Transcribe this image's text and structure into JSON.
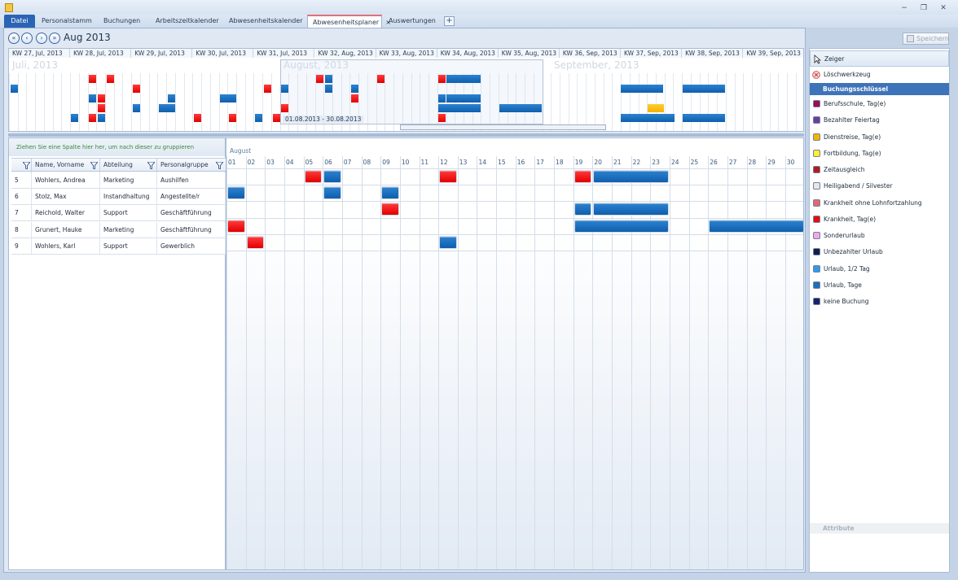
{
  "window": {
    "minimize": "−",
    "restore": "❐",
    "close": "✕"
  },
  "tabs": [
    {
      "label": "Datei"
    },
    {
      "label": "Personalstamm"
    },
    {
      "label": "Buchungen"
    },
    {
      "label": "Arbeitszeitkalender"
    },
    {
      "label": "Abwesenheitskalender"
    },
    {
      "label": "Abwesenheitsplaner"
    },
    {
      "label": "Auswertungen"
    }
  ],
  "tab_add": "+",
  "tab_close": "×",
  "nav": {
    "first": "«",
    "prev": "‹",
    "next": "›",
    "last": "»",
    "title": "Aug 2013"
  },
  "save_label": "Speichern",
  "overview": {
    "weeks": [
      "KW 27, Jul, 2013",
      "KW 28, Jul, 2013",
      "KW 29, Jul, 2013",
      "KW 30, Jul, 2013",
      "KW 31, Jul, 2013",
      "KW 32, Aug, 2013",
      "KW 33, Aug, 2013",
      "KW 34, Aug, 2013",
      "KW 35, Aug, 2013",
      "KW 36, Sep, 2013",
      "KW 37, Sep, 2013",
      "KW 38, Sep, 2013",
      "KW 39, Sep, 2013"
    ],
    "months": [
      "Juli, 2013",
      "August, 2013",
      "September, 2013"
    ],
    "range_label": "01.08.2013 - 30.08.2013"
  },
  "grid": {
    "group_hint": "Ziehen Sie eine Spalte hier her, um nach dieser zu gruppieren",
    "columns": [
      "Name, Vorname",
      "Abteilung",
      "Personalgruppe"
    ],
    "rows": [
      {
        "id": "5",
        "name": "Wohlers, Andrea",
        "dept": "Marketing",
        "group": "Aushilfen"
      },
      {
        "id": "6",
        "name": "Stolz, Max",
        "dept": "Instandhaltung",
        "group": "Angestellte/r"
      },
      {
        "id": "7",
        "name": "Reichold, Walter",
        "dept": "Support",
        "group": "Geschäftführung"
      },
      {
        "id": "8",
        "name": "Grunert, Hauke",
        "dept": "Marketing",
        "group": "Geschäftführung"
      },
      {
        "id": "9",
        "name": "Wohlers, Karl",
        "dept": "Support",
        "group": "Gewerblich"
      }
    ]
  },
  "calendar": {
    "month": "August",
    "days": [
      "01",
      "02",
      "03",
      "04",
      "05",
      "06",
      "07",
      "08",
      "09",
      "10",
      "11",
      "12",
      "13",
      "14",
      "15",
      "16",
      "17",
      "18",
      "19",
      "20",
      "21",
      "22",
      "23",
      "24",
      "25",
      "26",
      "27",
      "28",
      "29",
      "30"
    ],
    "bookings": [
      {
        "row": 0,
        "start": 5,
        "end": 5,
        "color": "red"
      },
      {
        "row": 0,
        "start": 6,
        "end": 6,
        "color": "blue"
      },
      {
        "row": 0,
        "start": 12,
        "end": 12,
        "color": "red"
      },
      {
        "row": 0,
        "start": 19,
        "end": 19,
        "color": "red"
      },
      {
        "row": 0,
        "start": 20,
        "end": 23,
        "color": "blue"
      },
      {
        "row": 1,
        "start": 1,
        "end": 1,
        "color": "blue"
      },
      {
        "row": 1,
        "start": 6,
        "end": 6,
        "color": "blue"
      },
      {
        "row": 1,
        "start": 9,
        "end": 9,
        "color": "blue"
      },
      {
        "row": 2,
        "start": 9,
        "end": 9,
        "color": "red"
      },
      {
        "row": 2,
        "start": 19,
        "end": 19,
        "color": "blue"
      },
      {
        "row": 2,
        "start": 20,
        "end": 23,
        "color": "blue"
      },
      {
        "row": 3,
        "start": 1,
        "end": 1,
        "color": "red"
      },
      {
        "row": 3,
        "start": 19,
        "end": 23,
        "color": "blue"
      },
      {
        "row": 3,
        "start": 26,
        "end": 30,
        "color": "blue"
      },
      {
        "row": 4,
        "start": 2,
        "end": 2,
        "color": "red"
      },
      {
        "row": 4,
        "start": 12,
        "end": 12,
        "color": "blue"
      }
    ]
  },
  "tools": {
    "pointer": "Zeiger",
    "eraser": "Löschwerkzeug",
    "keys_header": "Buchungsschlüssel",
    "attributes_header": "Attribute"
  },
  "booking_keys": [
    {
      "label": "Berufsschule, Tag(e)",
      "color": "#9c0d52"
    },
    {
      "label": "Bezahlter Feiertag",
      "color": "#6b3fa0"
    },
    {
      "label": "Dienstreise, Tag(e)",
      "color": "#f4b400"
    },
    {
      "label": "Fortbildung, Tag(e)",
      "color": "#ffee33"
    },
    {
      "label": "Zeitausgleich",
      "color": "#b01c1c"
    },
    {
      "label": "Heiligabend / Silvester",
      "color": "#e6e6e6"
    },
    {
      "label": "Krankheit ohne Lohnfortzahlung",
      "color": "#e06a6a"
    },
    {
      "label": "Krankheit, Tag(e)",
      "color": "#e80c0c"
    },
    {
      "label": "Sonderurlaub",
      "color": "#f0a8e8"
    },
    {
      "label": "Unbezahlter Urlaub",
      "color": "#0f1f4a"
    },
    {
      "label": "Urlaub, 1/2 Tag",
      "color": "#3399e6"
    },
    {
      "label": "Urlaub, Tage",
      "color": "#1e6cba"
    },
    {
      "label": "keine Buchung",
      "color": "#1c2266"
    }
  ]
}
